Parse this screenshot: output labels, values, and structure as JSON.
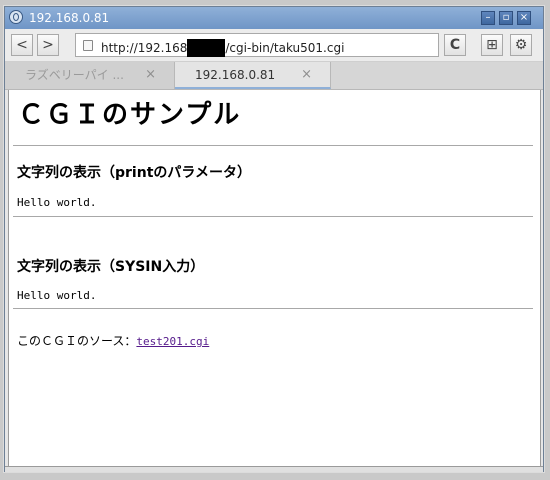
{
  "window": {
    "title": "192.168.0.81",
    "controls": {
      "minimize": "–",
      "maximize": "▫",
      "close": "×"
    }
  },
  "toolbar": {
    "back": "<",
    "forward": ">",
    "url_prefix": "http://192.168",
    "url_suffix": "/cgi-bin/taku501.cgi",
    "reload": "C",
    "newtab": "⊞",
    "settings": "⚙"
  },
  "tabs": [
    {
      "label": "ラズベリーパイ ...",
      "close": "×",
      "active": false
    },
    {
      "label": "192.168.0.81",
      "close": "×",
      "active": true
    }
  ],
  "page": {
    "heading": "ＣＧＩのサンプル",
    "section1_title": "文字列の表示（printのパラメータ）",
    "section1_output": "Hello world.",
    "section2_title": "文字列の表示（SYSIN入力）",
    "section2_output": "Hello world.",
    "source_label": "このＣＧＩのソース：",
    "source_link": "test201.cgi"
  },
  "colors": {
    "titlebar": "#7aa0cf",
    "link_visited": "#551a8b"
  }
}
